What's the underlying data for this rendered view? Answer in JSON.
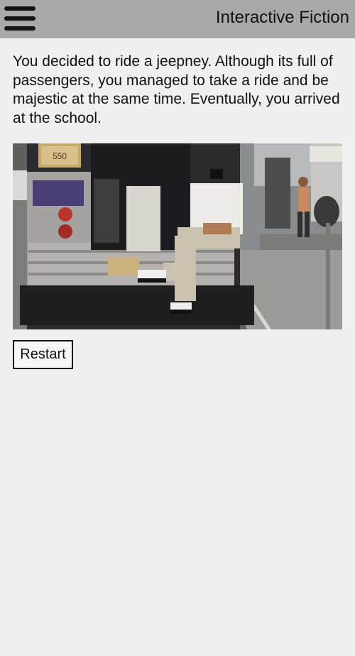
{
  "header": {
    "title": "Interactive Fiction",
    "menu_icon": "hamburger-menu-icon"
  },
  "story": {
    "text": "You decided to ride a jeepney. Although its full of passengers, you managed to take a ride and be majestic at the same time. Eventually, you arrived at the school.",
    "image_signs": {
      "left_sign": "550",
      "right_sign": "",
      "plate": ""
    }
  },
  "actions": {
    "restart_label": "Restart"
  },
  "colors": {
    "app_bar": "#a9a9a9",
    "background": "#f0f0f0",
    "text": "#111111"
  }
}
